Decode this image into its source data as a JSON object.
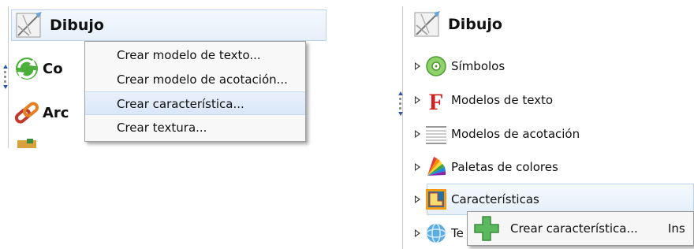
{
  "left_panel": {
    "header": {
      "title": "Dibujo"
    },
    "rows": [
      {
        "text": "Co",
        "icon": "refresh-icon"
      },
      {
        "text": "Arc",
        "icon": "link-icon"
      },
      {
        "text": "",
        "icon": "folder-icon"
      }
    ],
    "context_menu": {
      "items": [
        {
          "label": "Crear modelo de texto..."
        },
        {
          "label": "Crear modelo de acotación..."
        },
        {
          "label": "Crear característica...",
          "highlighted": true
        },
        {
          "label": "Crear textura..."
        }
      ]
    }
  },
  "right_panel": {
    "header": {
      "title": "Dibujo"
    },
    "tree": [
      {
        "label": "Símbolos",
        "icon": "symbols-icon"
      },
      {
        "label": "Modelos de texto",
        "icon": "text-style-icon"
      },
      {
        "label": "Modelos de acotación",
        "icon": "dimension-style-icon"
      },
      {
        "label": "Paletas de colores",
        "icon": "color-palette-icon"
      },
      {
        "label": "Características",
        "icon": "features-icon",
        "selected": true
      },
      {
        "label": "Te",
        "icon": "texture-icon"
      }
    ],
    "context_menu": {
      "item": {
        "label": "Crear característica...",
        "shortcut": "Ins",
        "icon": "add-icon"
      }
    }
  }
}
